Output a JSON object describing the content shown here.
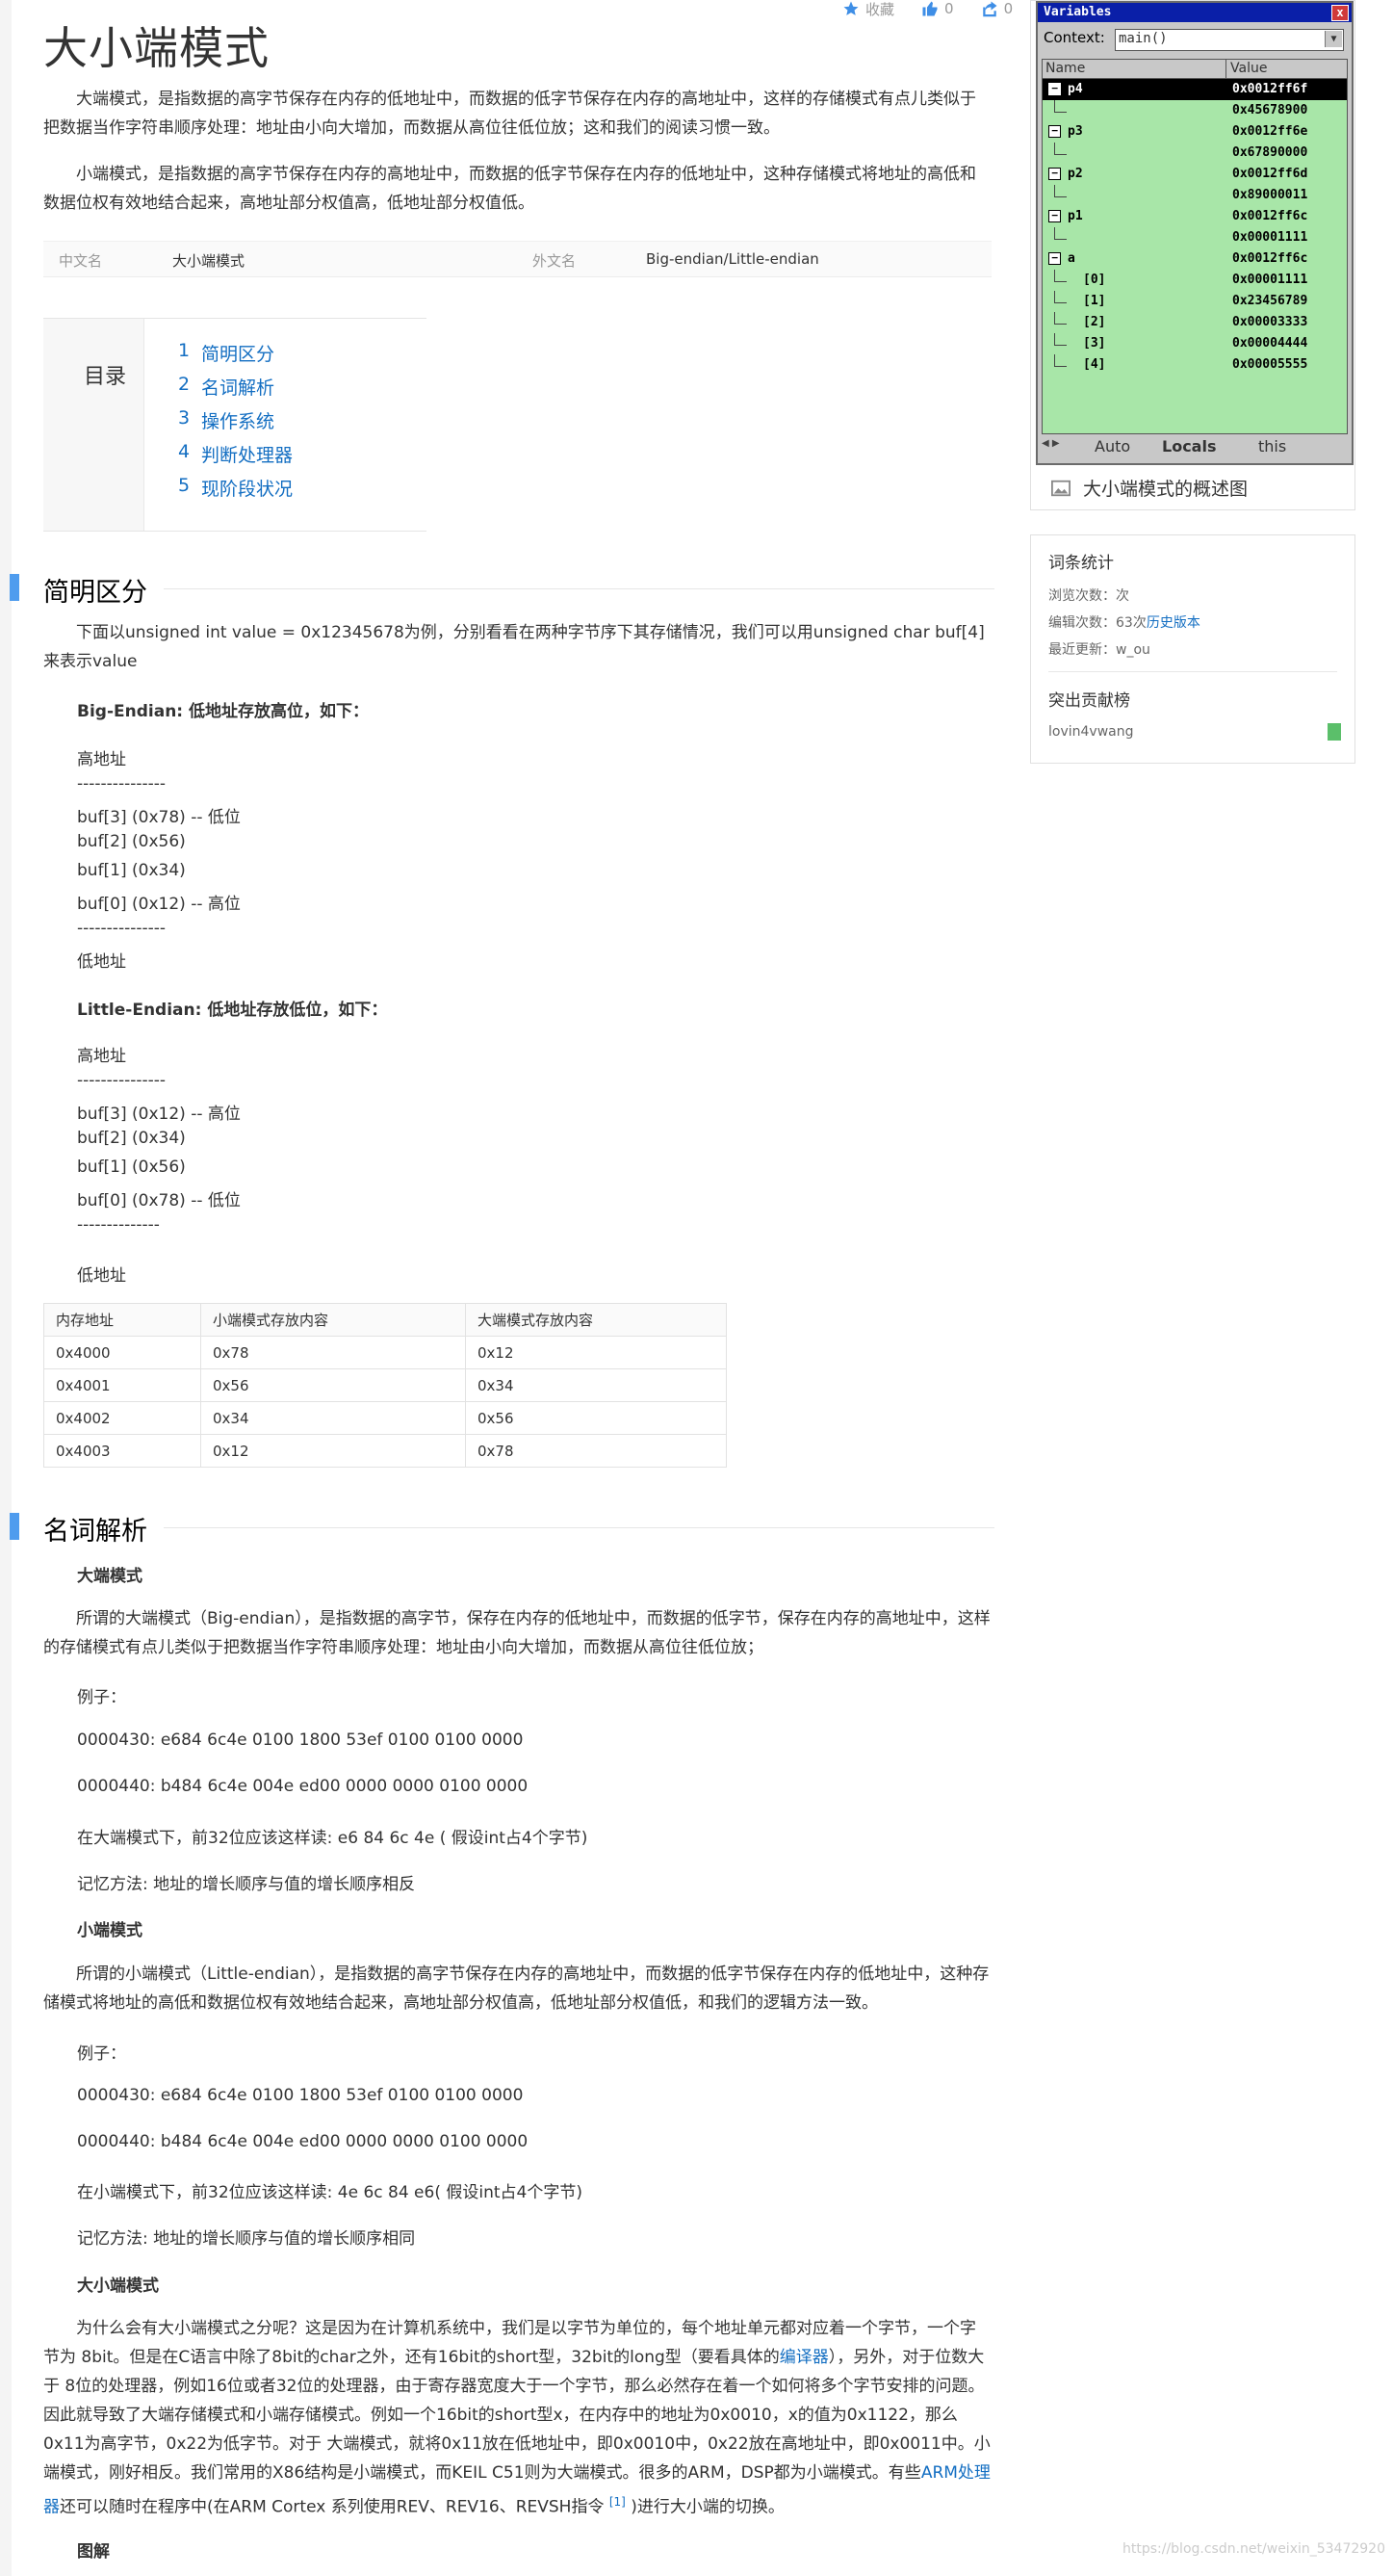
{
  "page": {
    "title": "大小端模式",
    "actions": [
      {
        "label": "收藏",
        "icon": "star-icon"
      },
      {
        "label": "0",
        "icon": "thumbs-up-icon"
      },
      {
        "label": "0",
        "icon": "share-icon"
      }
    ]
  },
  "intro": [
    "大端模式，是指数据的高字节保存在内存的低地址中，而数据的低字节保存在内存的高地址中，这样的存储模式有点儿类似于把数据当作字符串顺序处理：地址由小向大增加，而数据从高位往低位放；这和我们的阅读习惯一致。",
    "小端模式，是指数据的高字节保存在内存的高地址中，而数据的低字节保存在内存的低地址中，这种存储模式将地址的高低和数据位权有效地结合起来，高地址部分权值高，低地址部分权值低。"
  ],
  "infobox": {
    "cn_label": "中文名",
    "cn_value": "大小端模式",
    "en_label": "外文名",
    "en_value": "Big-endian/Little-endian"
  },
  "toc": {
    "label": "目录",
    "items": [
      {
        "num": "1",
        "label": "简明区分"
      },
      {
        "num": "2",
        "label": "名词解析"
      },
      {
        "num": "3",
        "label": "操作系统"
      },
      {
        "num": "4",
        "label": "判断处理器"
      },
      {
        "num": "5",
        "label": "现阶段状况"
      }
    ]
  },
  "section1": {
    "title": "简明区分",
    "intro": "下面以unsigned int value = 0x12345678为例，分别看看在两种字节序下其存储情况，我们可以用unsigned char buf[4]来表示value",
    "big_head": "Big-Endian: 低地址存放高位，如下：",
    "big_lines": [
      "高地址",
      "---------------",
      "buf[3] (0x78) -- 低位",
      "buf[2] (0x56)",
      "buf[1] (0x34)",
      "buf[0] (0x12) -- 高位",
      "---------------",
      "低地址"
    ],
    "little_head": "Little-Endian: 低地址存放低位，如下：",
    "little_lines": [
      "高地址",
      "---------------",
      "buf[3] (0x12) -- 高位",
      "buf[2] (0x34)",
      "buf[1] (0x56)",
      "buf[0] (0x78) -- 低位",
      "--------------",
      "低地址"
    ],
    "table": {
      "headers": [
        "内存地址",
        "小端模式存放内容",
        "大端模式存放内容"
      ],
      "rows": [
        [
          "0x4000",
          "0x78",
          "0x12"
        ],
        [
          "0x4001",
          "0x56",
          "0x34"
        ],
        [
          "0x4002",
          "0x34",
          "0x56"
        ],
        [
          "0x4003",
          "0x12",
          "0x78"
        ]
      ]
    }
  },
  "section2": {
    "title": "名词解析",
    "big_title": "大端模式",
    "big_desc": "所谓的大端模式（Big-endian），是指数据的高字节，保存在内存的低地址中，而数据的低字节，保存在内存的高地址中，这样的存储模式有点儿类似于把数据当作字符串顺序处理：地址由小向大增加，而数据从高位往低位放；",
    "example_label": "例子：",
    "hex1": "0000430: e684 6c4e 0100 1800 53ef 0100 0100 0000",
    "hex2": "0000440: b484 6c4e 004e ed00 0000 0000 0100 0000",
    "big_read": "在大端模式下，前32位应该这样读: e6 84 6c 4e ( 假设int占4个字节)",
    "big_memo": "记忆方法: 地址的增长顺序与值的增长顺序相反",
    "little_title": "小端模式",
    "little_desc": "所谓的小端模式（Little-endian），是指数据的高字节保存在内存的高地址中，而数据的低字节保存在内存的低地址中，这种存储模式将地址的高低和数据位权有效地结合起来，高地址部分权值高，低地址部分权值低，和我们的逻辑方法一致。",
    "little_read": "在小端模式下，前32位应该这样读: 4e 6c 84 e6( 假设int占4个字节)",
    "little_memo": "记忆方法: 地址的增长顺序与值的增长顺序相同",
    "both_title": "大小端模式",
    "both_desc_1": "为什么会有大小端模式之分呢？这是因为在计算机系统中，我们是以字节为单位的，每个地址单元都对应着一个字节，一个字节为 8bit。但是在C语言中除了8bit的char之外，还有16bit的short型，32bit的long型（要看具体的",
    "both_link_1": "编译器",
    "both_desc_2": "），另外，对于位数大于 8位的处理器，例如16位或者32位的处理器，由于寄存器宽度大于一个字节，那么必然存在着一个如何将多个字节安排的问题。因此就导致了大端存储模式和小端存储模式。例如一个16bit的short型x，在内存中的地址为0x0010，x的值为0x1122，那么0x11为高字节，0x22为低字节。对于 大端模式，就将0x11放在低地址中，即0x0010中，0x22放在高地址中，即0x0011中。小端模式，刚好相反。我们常用的X86结构是小端模式，而KEIL C51则为大端模式。很多的ARM，DSP都为小端模式。有些",
    "both_link_2": "ARM处理器",
    "both_desc_3": "还可以随时在程序中(在ARM Cortex 系列使用REV、REV16、REVSH指令",
    "ref": "[1]",
    "both_desc_4": ")进行大小端的切换。",
    "diagram_title": "图解"
  },
  "sidebar": {
    "variables": {
      "title": "Variables",
      "close": "x",
      "context_label": "Context:",
      "context_value": "main()",
      "col_name": "Name",
      "col_value": "Value",
      "rows": [
        {
          "name": "p4",
          "value": "0x0012ff6f",
          "kind": "node",
          "selected": true
        },
        {
          "name": "",
          "value": "0x45678900",
          "kind": "leaf"
        },
        {
          "name": "p3",
          "value": "0x0012ff6e",
          "kind": "node"
        },
        {
          "name": "",
          "value": "0x67890000",
          "kind": "leaf"
        },
        {
          "name": "p2",
          "value": "0x0012ff6d",
          "kind": "node"
        },
        {
          "name": "",
          "value": "0x89000011",
          "kind": "leaf"
        },
        {
          "name": "p1",
          "value": "0x0012ff6c",
          "kind": "node"
        },
        {
          "name": "",
          "value": "0x00001111",
          "kind": "leaf"
        },
        {
          "name": "a",
          "value": "0x0012ff6c",
          "kind": "node"
        },
        {
          "name": "[0]",
          "value": "0x00001111",
          "kind": "leaf"
        },
        {
          "name": "[1]",
          "value": "0x23456789",
          "kind": "leaf"
        },
        {
          "name": "[2]",
          "value": "0x00003333",
          "kind": "leaf"
        },
        {
          "name": "[3]",
          "value": "0x00004444",
          "kind": "leaf"
        },
        {
          "name": "[4]",
          "value": "0x00005555",
          "kind": "leaf"
        }
      ],
      "tabs": [
        "Auto",
        "Locals",
        "this"
      ]
    },
    "caption": "大小端模式的概述图",
    "stats": {
      "title": "词条统计",
      "views": "浏览次数：次",
      "edits_prefix": "编辑次数：63次",
      "edits_link": "历史版本",
      "updated": "最近更新：w_ou",
      "contrib_title": "突出贡献榜",
      "contributor": "lovin4vwang"
    }
  },
  "watermark": "https://blog.csdn.net/weixin_53472920"
}
